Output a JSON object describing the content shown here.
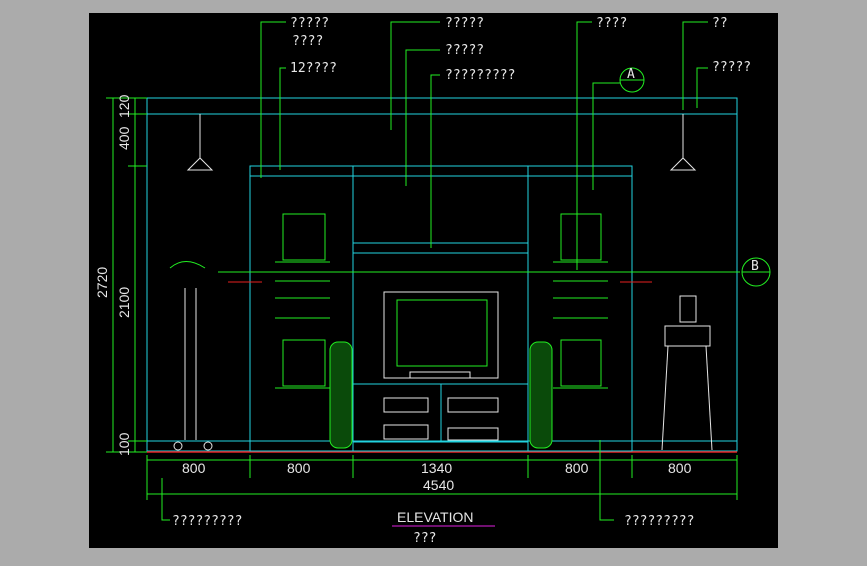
{
  "drawing": {
    "title": "ELEVATION",
    "subtitle": "???",
    "colors": {
      "background": "#000000",
      "frame_gray": "#ababab",
      "cyan": "#22d3e0",
      "green": "#22ee22",
      "red": "#e62020",
      "white": "#e6e6e6",
      "magenta": "#e020e0",
      "yellow": "#e6e600"
    },
    "callouts": {
      "top_left_1": "?????",
      "top_left_2": "????",
      "left_12": "12????",
      "center_1": "?????",
      "center_2": "?????",
      "center_3": "?????????",
      "right_1": "????",
      "right_2": "??",
      "right_3": "?????",
      "bottom_left": "?????????",
      "bottom_right": "?????????"
    },
    "section_markers": {
      "a": "A",
      "b": "B"
    },
    "horizontal_dims": {
      "segments": [
        "800",
        "800",
        "1340",
        "800",
        "800"
      ],
      "total": "4540"
    },
    "vertical_dims": {
      "outer_total": "2720",
      "inner_2100": "2100",
      "top_120": "120",
      "top_400": "400",
      "bottom_100": "100"
    }
  }
}
